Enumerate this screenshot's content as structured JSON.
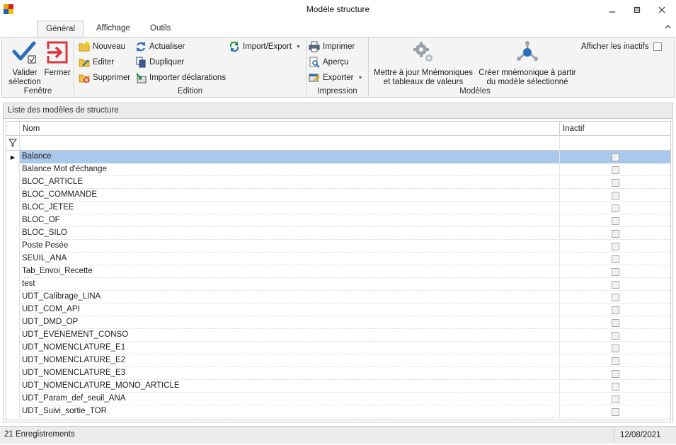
{
  "window": {
    "title": "Modèle structure",
    "minimize": "–",
    "maximize": "▢",
    "close": "✕"
  },
  "tabs": [
    {
      "label": "Général",
      "active": true
    },
    {
      "label": "Affichage",
      "active": false
    },
    {
      "label": "Outils",
      "active": false
    }
  ],
  "ribbon": {
    "fenetre": {
      "label": "Fenêtre",
      "valider": "Valider sélection",
      "valider_l1": "Valider",
      "valider_l2": "sélection",
      "fermer": "Fermer"
    },
    "edition": {
      "label": "Edition",
      "nouveau": "Nouveau",
      "editer": "Editer",
      "supprimer": "Supprimer",
      "actualiser": "Actualiser",
      "dupliquer": "Dupliquer",
      "importer": "Importer déclarations",
      "import_export": "Import/Export"
    },
    "impression": {
      "label": "Impression",
      "imprimer": "Imprimer",
      "apercu": "Aperçu",
      "exporter": "Exporter"
    },
    "modeles": {
      "label": "Modèles",
      "mettre_a_jour_l1": "Mettre à jour Mnémoniques",
      "mettre_a_jour_l2": "et tableaux de valeurs",
      "creer_l1": "Créer mnémonique à partir",
      "creer_l2": "du modèle sélectionné",
      "afficher_inactifs": "Afficher les inactifs"
    }
  },
  "grid": {
    "panel_title": "Liste des modèles de structure",
    "columns": {
      "nom": "Nom",
      "inactif": "Inactif"
    },
    "selected_index": 0,
    "rows": [
      {
        "nom": "Balance",
        "inactif": false
      },
      {
        "nom": "Balance Mot d'échange",
        "inactif": false
      },
      {
        "nom": "BLOC_ARTICLE",
        "inactif": false
      },
      {
        "nom": "BLOC_COMMANDE",
        "inactif": false
      },
      {
        "nom": "BLOC_JETEE",
        "inactif": false
      },
      {
        "nom": "BLOC_OF",
        "inactif": false
      },
      {
        "nom": "BLOC_SILO",
        "inactif": false
      },
      {
        "nom": "Poste Pesée",
        "inactif": false
      },
      {
        "nom": "SEUIL_ANA",
        "inactif": false
      },
      {
        "nom": "Tab_Envoi_Recette",
        "inactif": false
      },
      {
        "nom": "test",
        "inactif": false
      },
      {
        "nom": "UDT_Calibrage_LINA",
        "inactif": false
      },
      {
        "nom": "UDT_COM_API",
        "inactif": false
      },
      {
        "nom": "UDT_DMD_OP",
        "inactif": false
      },
      {
        "nom": "UDT_EVENEMENT_CONSO",
        "inactif": false
      },
      {
        "nom": "UDT_NOMENCLATURE_E1",
        "inactif": false
      },
      {
        "nom": "UDT_NOMENCLATURE_E2",
        "inactif": false
      },
      {
        "nom": "UDT_NOMENCLATURE_E3",
        "inactif": false
      },
      {
        "nom": "UDT_NOMENCLATURE_MONO_ARTICLE",
        "inactif": false
      },
      {
        "nom": "UDT_Param_def_seuil_ANA",
        "inactif": false
      },
      {
        "nom": "UDT_Suivi_sortie_TOR",
        "inactif": false
      }
    ]
  },
  "status": {
    "count": "21 Enregistrements",
    "date": "12/08/2021"
  },
  "colors": {
    "selection": "#a8c8ec",
    "ribbon_bg": "#f4f4f4",
    "accent_blue": "#2a6fb8",
    "close_red": "#d9363e"
  }
}
